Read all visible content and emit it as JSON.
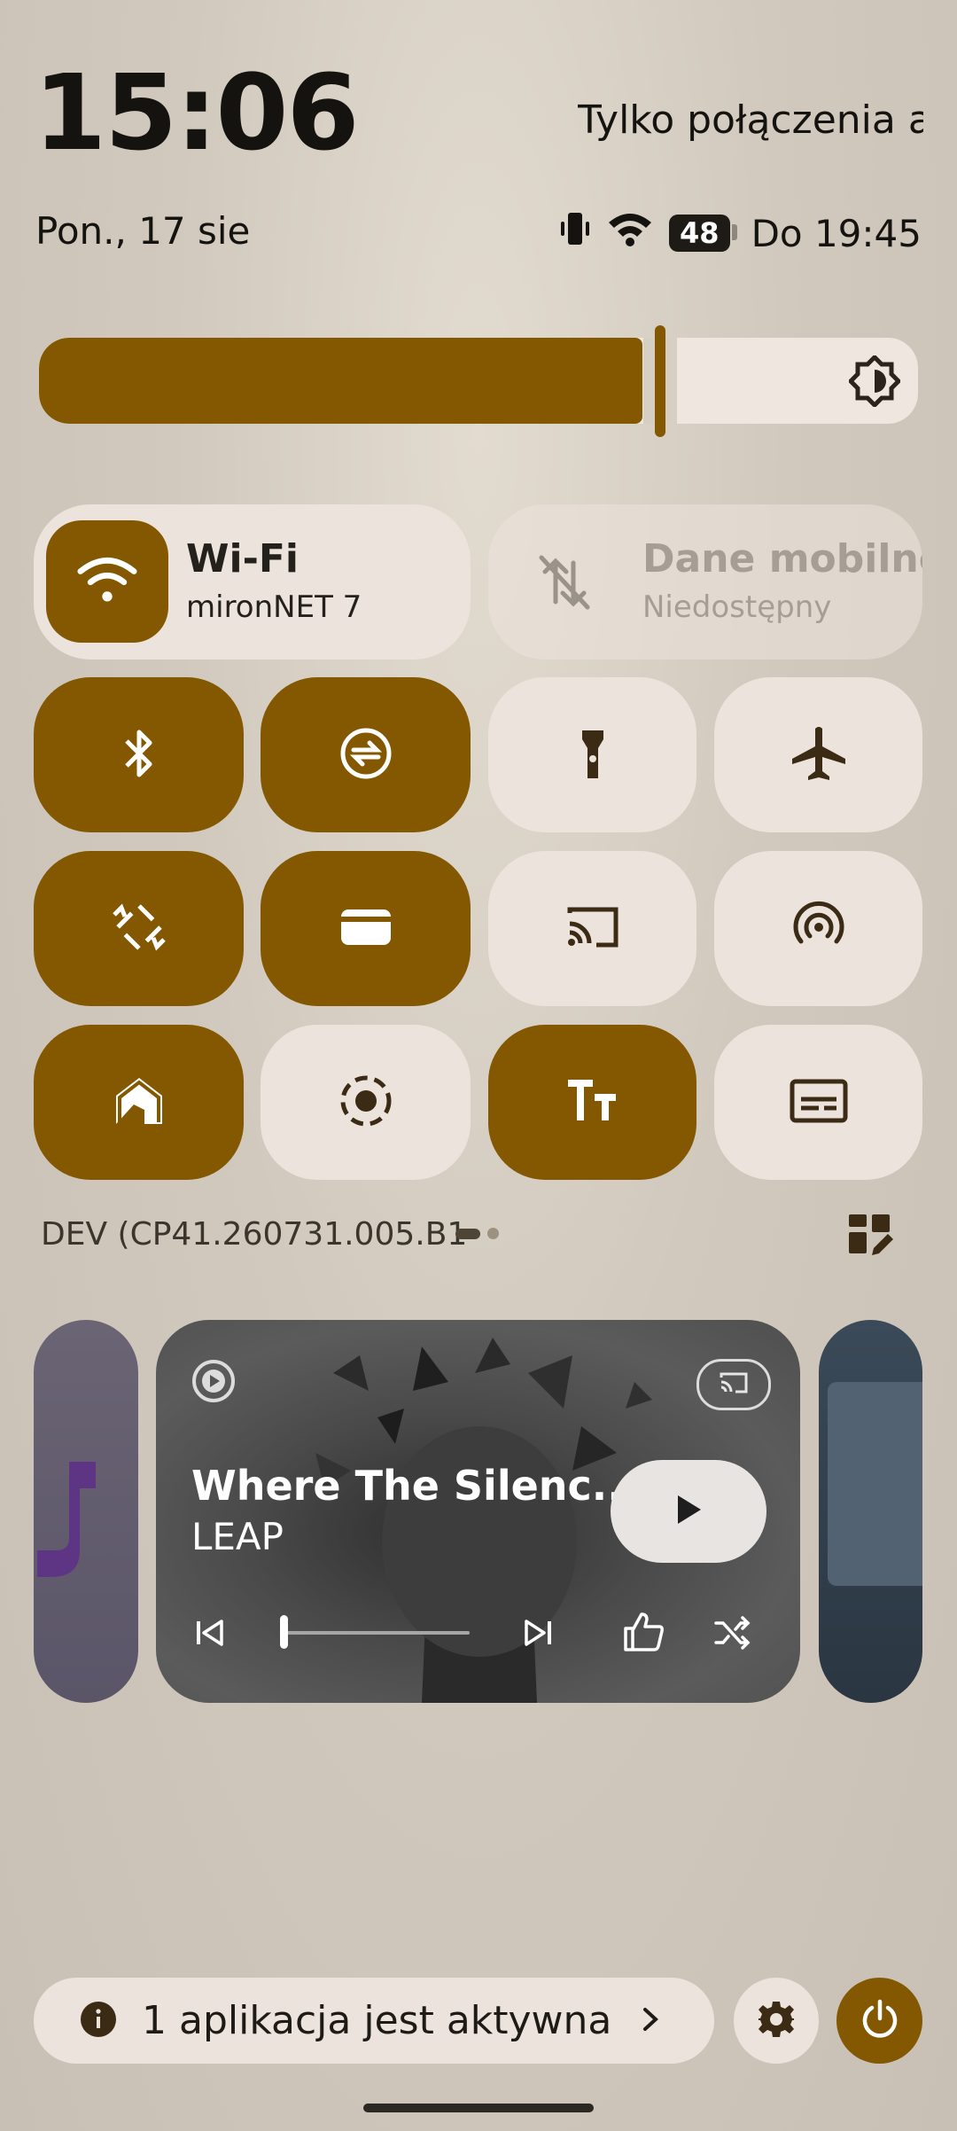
{
  "header": {
    "time": "15:06",
    "call_status": "Tylko połączenia a",
    "date": "Pon., 17 sie",
    "battery_level": "48",
    "alarm": "Do 19:45"
  },
  "brightness": {
    "level_fraction": 0.73
  },
  "wifi_tile": {
    "title": "Wi-Fi",
    "subtitle": "mironNET 7"
  },
  "mobile_tile": {
    "title": "Dane mobilne",
    "subtitle": "Niedostępny"
  },
  "build": {
    "label": "DEV (CP41.260731.005.B1"
  },
  "media": {
    "title": "Where The Silenc...",
    "artist": "LEAP",
    "progress_fraction": 0.02
  },
  "footer": {
    "active_apps": "1 aplikacja jest aktywna"
  },
  "colors": {
    "accent": "#835800",
    "tile_off": "#ece3dc"
  }
}
